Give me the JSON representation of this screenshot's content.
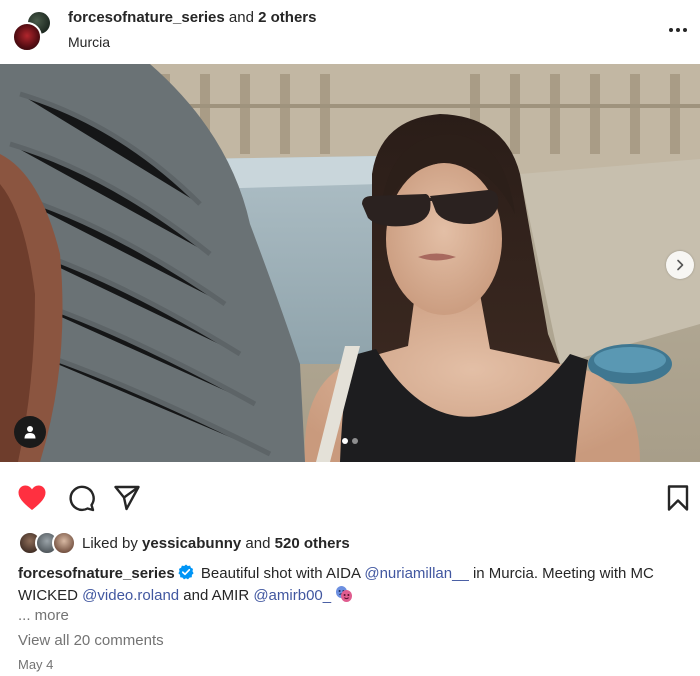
{
  "header": {
    "username": "forcesofnature_series",
    "and_text": " and ",
    "others_text": "2 others",
    "location": "Murcia"
  },
  "photo": {
    "carousel_total": 2,
    "carousel_active": 1
  },
  "likes": {
    "prefix": "Liked by ",
    "user": "yessicabunny",
    "middle": " and ",
    "others": "520 others"
  },
  "caption": {
    "username": "forcesofnature_series",
    "text_1": " Beautiful shot with AIDA ",
    "mention_1": "@nuriamillan__",
    "text_2": " in Murcia. Meeting with MC WICKED ",
    "mention_2": "@video.roland",
    "text_3": " and AMIR ",
    "mention_3": "@amirb00_",
    "more_label": "... more"
  },
  "comments": {
    "view_all": "View all 20 comments"
  },
  "date": "May 4",
  "colors": {
    "like_red": "#ff3040",
    "mention_blue": "#4157a0",
    "verified_blue": "#0095f6",
    "muted_text": "#737373"
  },
  "icons": [
    "more-horizontal-icon",
    "chevron-right-icon",
    "user-tag-icon",
    "heart-icon",
    "comment-icon",
    "share-icon",
    "bookmark-icon",
    "verified-badge-icon",
    "performing-arts-emoji"
  ]
}
